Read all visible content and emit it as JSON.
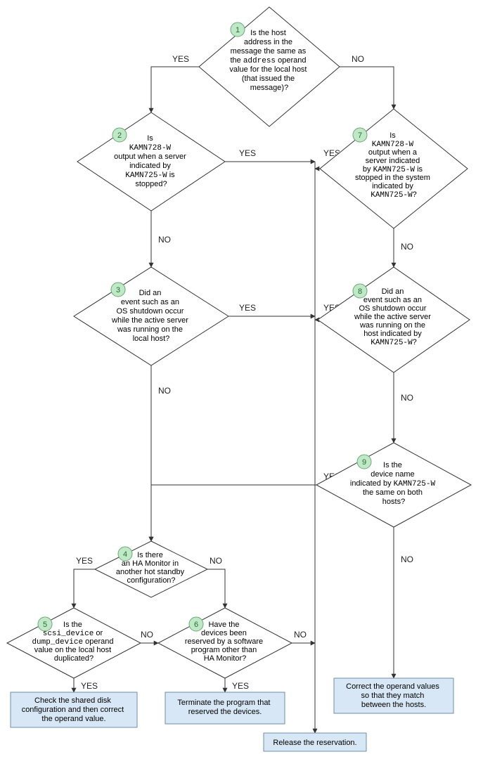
{
  "chart_data": {
    "type": "flowchart",
    "nodes": [
      {
        "id": 1,
        "kind": "decision",
        "text_lines": [
          "Is the host",
          "address in the",
          "message the same as",
          "the address operand",
          "value for the local host",
          "(that issued the",
          "message)?"
        ],
        "mono_words": [
          "address"
        ]
      },
      {
        "id": 2,
        "kind": "decision",
        "text_lines": [
          "Is",
          "KAMN728-W",
          "output when a server",
          "indicated by",
          "KAMN725-W is",
          "stopped?"
        ],
        "mono_words": [
          "KAMN728-W",
          "KAMN725-W"
        ]
      },
      {
        "id": 3,
        "kind": "decision",
        "text_lines": [
          "Did an",
          "event such as an",
          "OS shutdown occur",
          "while the active server",
          "was running on the",
          "local host?"
        ]
      },
      {
        "id": 4,
        "kind": "decision",
        "text_lines": [
          "Is there",
          "an HA Monitor in",
          "another hot standby",
          "configuration?"
        ]
      },
      {
        "id": 5,
        "kind": "decision",
        "text_lines": [
          "Is the",
          "scsi_device or",
          "dump_device operand",
          "value on the local host",
          "duplicated?"
        ],
        "mono_words": [
          "scsi_device",
          "dump_device"
        ]
      },
      {
        "id": 6,
        "kind": "decision",
        "text_lines": [
          "Have the",
          "devices been",
          "reserved by a software",
          "program other than",
          "HA Monitor?"
        ]
      },
      {
        "id": 7,
        "kind": "decision",
        "text_lines": [
          "Is",
          "KAMN728-W",
          "output when a",
          "server indicated",
          "by KAMN725-W is",
          "stopped in the system",
          "indicated by",
          "KAMN725-W?"
        ],
        "mono_words": [
          "KAMN728-W",
          "KAMN725-W"
        ]
      },
      {
        "id": 8,
        "kind": "decision",
        "text_lines": [
          "Did an",
          "event such as an",
          "OS shutdown occur",
          "while the active server",
          "was running on the",
          "host indicated by",
          "KAMN725-W?"
        ],
        "mono_words": [
          "KAMN725-W"
        ]
      },
      {
        "id": 9,
        "kind": "decision",
        "text_lines": [
          "Is the",
          "device name",
          "indicated by KAMN725-W",
          "the same on both",
          "hosts?"
        ],
        "mono_words": [
          "KAMN725-W"
        ]
      },
      {
        "id": "A",
        "kind": "action",
        "text_lines": [
          "Check the shared disk",
          "configuration and then correct",
          "the operand value."
        ]
      },
      {
        "id": "B",
        "kind": "action",
        "text_lines": [
          "Terminate the program that",
          "reserved the devices."
        ]
      },
      {
        "id": "C",
        "kind": "action",
        "text_lines": [
          "Release the reservation."
        ]
      },
      {
        "id": "D",
        "kind": "action",
        "text_lines": [
          "Correct the operand values",
          "so that they match",
          "between the hosts."
        ]
      }
    ],
    "edges": [
      {
        "from": 1,
        "to": 2,
        "label": "YES"
      },
      {
        "from": 1,
        "to": 7,
        "label": "NO"
      },
      {
        "from": 2,
        "to": "merge-C",
        "label": "YES"
      },
      {
        "from": 2,
        "to": 3,
        "label": "NO"
      },
      {
        "from": 3,
        "to": "merge-C",
        "label": "YES"
      },
      {
        "from": 3,
        "to": 4,
        "label": "NO"
      },
      {
        "from": 4,
        "to": 5,
        "label": "YES"
      },
      {
        "from": 4,
        "to": 6,
        "label": "NO"
      },
      {
        "from": 5,
        "to": "A",
        "label": "YES"
      },
      {
        "from": 5,
        "to": 6,
        "label": "NO"
      },
      {
        "from": 6,
        "to": "B",
        "label": "YES"
      },
      {
        "from": 6,
        "to": "merge-C",
        "label": "NO"
      },
      {
        "from": 7,
        "to": "merge-C",
        "label": "YES"
      },
      {
        "from": 7,
        "to": 8,
        "label": "NO"
      },
      {
        "from": 8,
        "to": "merge-C",
        "label": "YES"
      },
      {
        "from": 8,
        "to": 9,
        "label": "NO"
      },
      {
        "from": 9,
        "to": 4,
        "label": "YES"
      },
      {
        "from": 9,
        "to": "D",
        "label": "NO"
      },
      {
        "from": "merge-C",
        "to": "C",
        "label": ""
      }
    ]
  },
  "labels": {
    "yes": "YES",
    "no": "NO"
  },
  "n1": {
    "l1": "Is the host",
    "l2": "address in the",
    "l3a": "message the same as",
    "l4a": "the ",
    "l4b": "address",
    "l4c": " operand",
    "l5": "value for the local host",
    "l6": "(that issued the",
    "l7": "message)?"
  },
  "n2": {
    "l1": "Is",
    "l2": "KAMN728-W",
    "l3": "output when a server",
    "l4": "indicated by",
    "l5a": "KAMN725-W",
    "l5b": " is",
    "l6": "stopped?"
  },
  "n3": {
    "l1": "Did an",
    "l2": "event such as an",
    "l3": "OS shutdown occur",
    "l4": "while the active server",
    "l5": "was running on the",
    "l6": "local host?"
  },
  "n4": {
    "l1": "Is there",
    "l2": "an HA Monitor in",
    "l3": "another hot standby",
    "l4": "configuration?"
  },
  "n5": {
    "l1": "Is the",
    "l2a": "scsi_device",
    "l2b": " or",
    "l3a": "dump_device",
    "l3b": " operand",
    "l4": "value on the local host",
    "l5": "duplicated?"
  },
  "n6": {
    "l1": "Have the",
    "l2": "devices been",
    "l3": "reserved by a software",
    "l4": "program other than",
    "l5": "HA Monitor?"
  },
  "n7": {
    "l1": "Is",
    "l2": "KAMN728-W",
    "l3": "output when a",
    "l4": "server indicated",
    "l5a": "by ",
    "l5b": "KAMN725-W",
    "l5c": " is",
    "l6": "stopped in the system",
    "l7": "indicated by",
    "l8a": "KAMN725-W",
    "l8b": "?"
  },
  "n8": {
    "l1": "Did an",
    "l2": "event such as an",
    "l3": "OS shutdown occur",
    "l4": "while the active server",
    "l5": "was running on the",
    "l6": "host indicated by",
    "l7a": "KAMN725-W",
    "l7b": "?"
  },
  "n9": {
    "l1": "Is the",
    "l2": "device name",
    "l3a": "indicated by ",
    "l3b": "KAMN725-W",
    "l4": "the same on both",
    "l5": "hosts?"
  },
  "actA": {
    "l1": "Check the shared disk",
    "l2": "configuration and then correct",
    "l3": "the operand value."
  },
  "actB": {
    "l1": "Terminate the program that",
    "l2": "reserved the devices."
  },
  "actC": {
    "l1": "Release the reservation."
  },
  "actD": {
    "l1": "Correct the operand values",
    "l2": "so that they match",
    "l3": "between the hosts."
  },
  "badges": {
    "b1": "1",
    "b2": "2",
    "b3": "3",
    "b4": "4",
    "b5": "5",
    "b6": "6",
    "b7": "7",
    "b8": "8",
    "b9": "9"
  }
}
